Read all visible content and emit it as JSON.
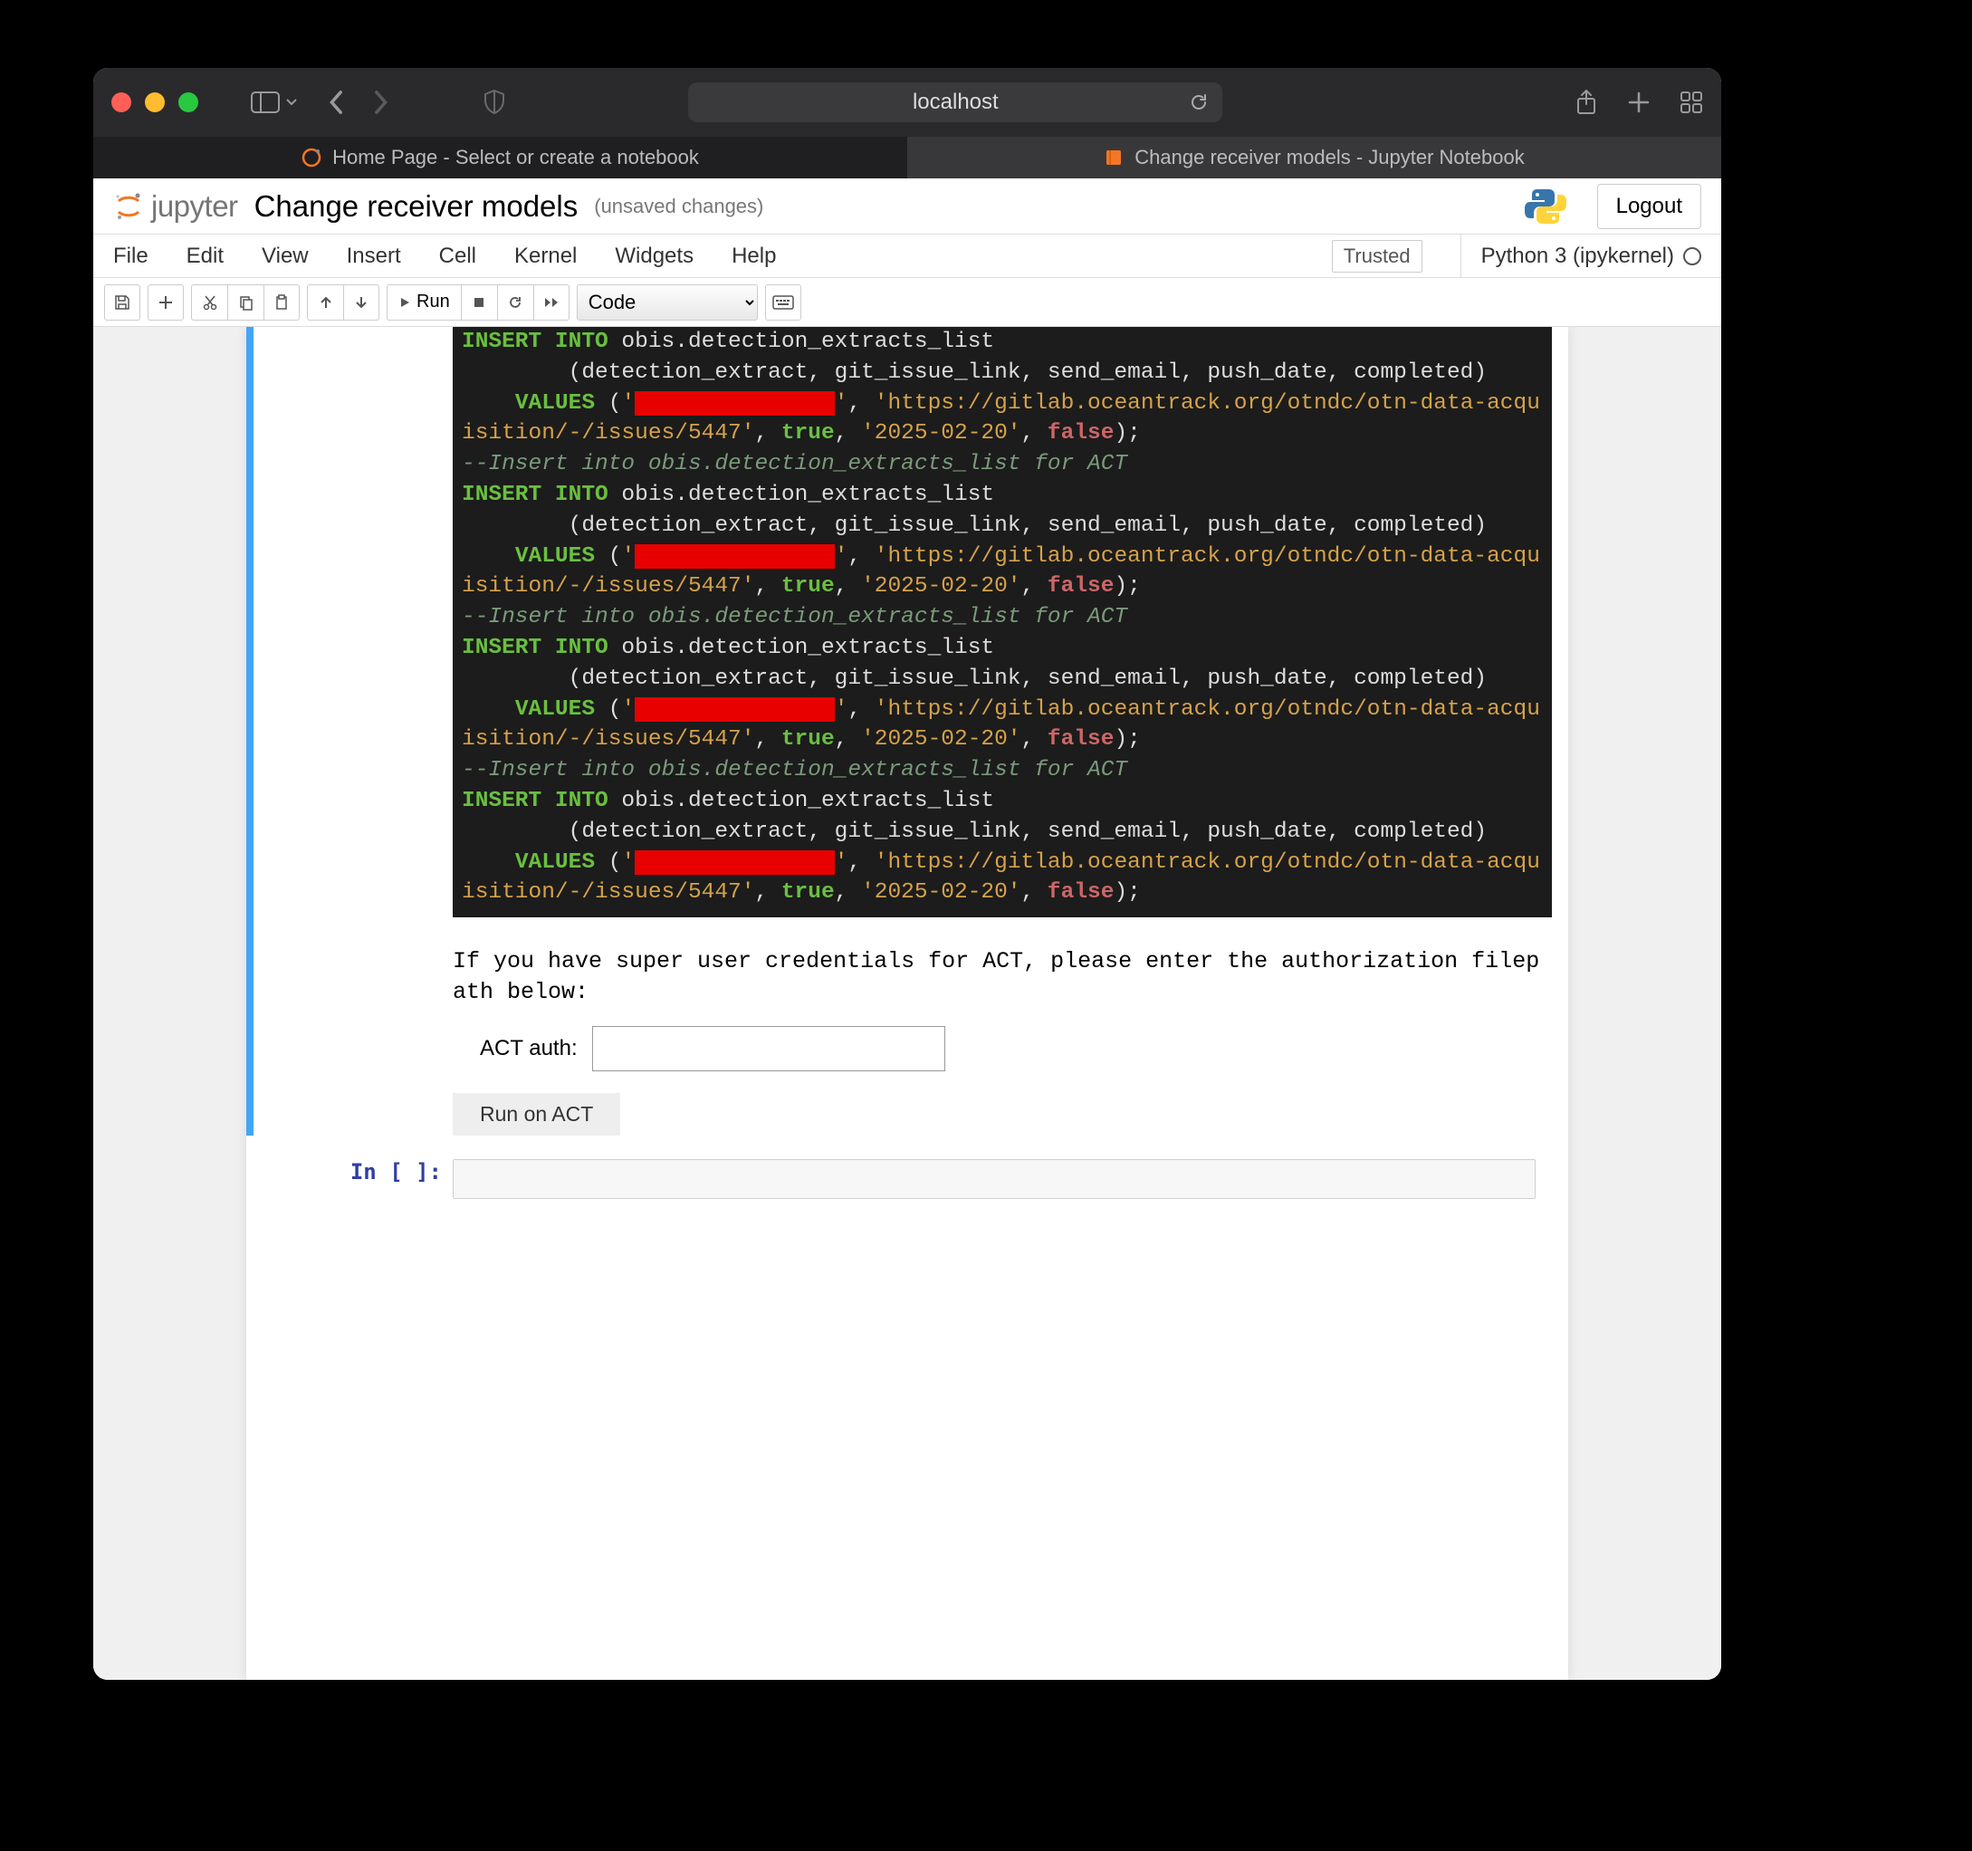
{
  "browser": {
    "address": "localhost",
    "tabs": [
      {
        "label": "Home Page - Select or create a notebook",
        "active": false
      },
      {
        "label": "Change receiver models - Jupyter Notebook",
        "active": true
      }
    ]
  },
  "header": {
    "brand": "jupyter",
    "title": "Change receiver models",
    "subtitle": "(unsaved changes)",
    "logout": "Logout"
  },
  "menu": {
    "items": [
      "File",
      "Edit",
      "View",
      "Insert",
      "Cell",
      "Kernel",
      "Widgets",
      "Help"
    ],
    "trusted": "Trusted",
    "kernel": "Python 3 (ipykernel)"
  },
  "toolbar": {
    "run": "Run",
    "cell_type": "Code"
  },
  "code": {
    "insert": "INSERT INTO",
    "tablefrag": " obis.detection_extracts_list",
    "cols": "        (detection_extract, git_issue_link, send_email, push_date, completed)",
    "values_kw": "VALUES",
    "open": " (",
    "q": "'",
    "redacted": "               ",
    "sep": ", ",
    "url": "'https://gitlab.oceantrack.org/otndc/otn-data-acquisition/-/issues/5447'",
    "true": "true",
    "date": "'2025-02-20'",
    "false": "false",
    "end": ");",
    "comment": "--Insert into obis.detection_extracts_list for ACT"
  },
  "output": {
    "prompt_text": "If you have super user credentials for ACT, please enter the authorization filepath below:",
    "auth_label": "ACT auth:",
    "auth_value": "",
    "run_act": "Run on ACT"
  },
  "empty": {
    "prompt": "In [ ]:"
  }
}
